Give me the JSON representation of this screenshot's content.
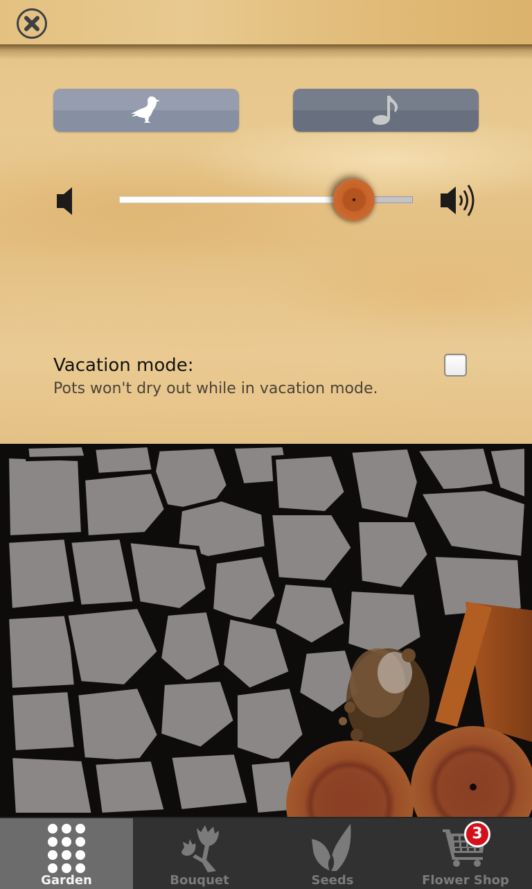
{
  "settings": {
    "close_icon": "close-circle-icon",
    "sound_effects_button": {
      "icon": "bird-icon",
      "active": true
    },
    "music_button": {
      "icon": "music-note-icon",
      "active": false
    },
    "volume": {
      "low_icon": "speaker-low-icon",
      "high_icon": "speaker-high-icon",
      "value_fraction": 0.8
    },
    "vacation_mode": {
      "title": "Vacation mode:",
      "description": "Pots won't dry out while in vacation mode.",
      "checked": false
    }
  },
  "garden": {
    "scene": "stone path with terracotta pots and spilled soil"
  },
  "bottom_nav": {
    "tabs": [
      {
        "label": "Garden",
        "icon": "grid-dots-icon",
        "active": true
      },
      {
        "label": "Bouquet",
        "icon": "flower-icon",
        "active": false
      },
      {
        "label": "Seeds",
        "icon": "leaf-icon",
        "active": false
      },
      {
        "label": "Flower Shop",
        "icon": "cart-icon",
        "active": false,
        "badge": "3"
      }
    ]
  },
  "colors": {
    "badge": "#d4111a",
    "active_tab": "#6c6c6c",
    "nav_bg": "#313131",
    "slider_thumb": "#c7632a"
  }
}
